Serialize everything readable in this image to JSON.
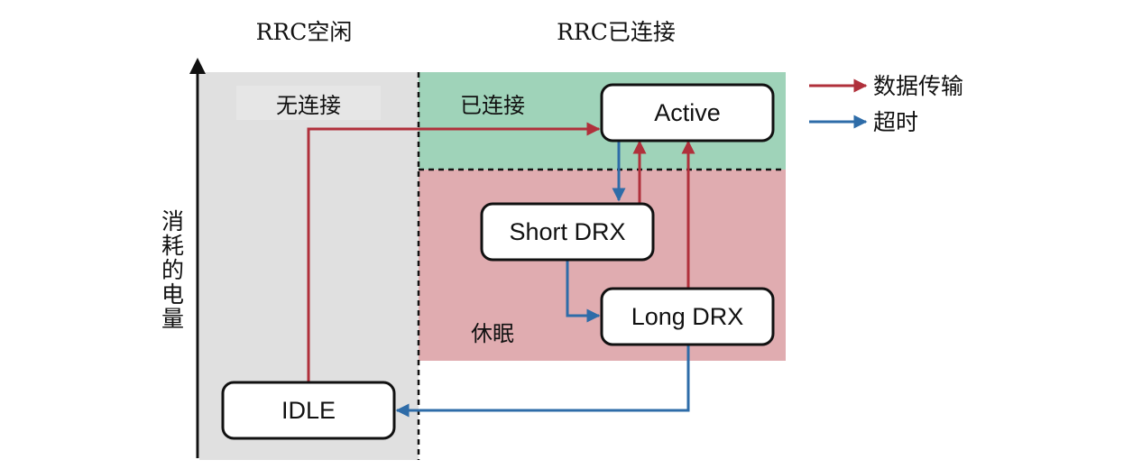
{
  "headers": {
    "idle_group": "RRC空闲",
    "connected_group": "RRC已连接"
  },
  "regions": {
    "no_connection": "无连接",
    "connected": "已连接",
    "sleep": "休眠"
  },
  "y_axis_label": "消耗的电量",
  "states": {
    "active": "Active",
    "short_drx": "Short DRX",
    "long_drx": "Long DRX",
    "idle": "IDLE"
  },
  "legend": {
    "data_transfer": "数据传输",
    "timeout": "超时"
  },
  "colors": {
    "data_arrow": "#b0303b",
    "timeout_arrow": "#2e6ca8",
    "idle_region": "#e0e0e0",
    "connected_region": "#9fd3b9",
    "sleep_region": "#e0acb0"
  }
}
